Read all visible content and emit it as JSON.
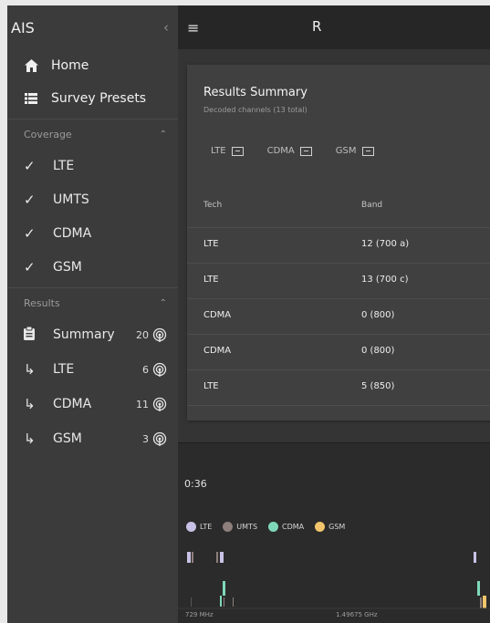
{
  "app": {
    "title": "AIS",
    "collapse_icon": "chevron-left-icon"
  },
  "topbar": {
    "menu_icon": "hamburger-icon",
    "title_fragment": "R"
  },
  "sidebar": {
    "nav": [
      {
        "label": "Home",
        "icon": "home-icon"
      },
      {
        "label": "Survey Presets",
        "icon": "list-icon"
      }
    ],
    "coverage": {
      "title": "Coverage",
      "items": [
        {
          "label": "LTE"
        },
        {
          "label": "UMTS"
        },
        {
          "label": "CDMA"
        },
        {
          "label": "GSM"
        }
      ]
    },
    "results": {
      "title": "Results",
      "items": [
        {
          "label": "Summary",
          "count": "20",
          "icon": "clipboard-icon"
        },
        {
          "label": "LTE",
          "count": "6",
          "icon": "subdirectory-arrow-icon"
        },
        {
          "label": "CDMA",
          "count": "11",
          "icon": "subdirectory-arrow-icon"
        },
        {
          "label": "GSM",
          "count": "3",
          "icon": "subdirectory-arrow-icon"
        }
      ]
    }
  },
  "card": {
    "title": "Results Summary",
    "subtitle": "Decoded channels (13 total)",
    "filters": [
      "LTE",
      "CDMA",
      "GSM"
    ],
    "columns": [
      "Tech",
      "Band"
    ],
    "rows": [
      {
        "tech": "LTE",
        "band": "12 (700 a)"
      },
      {
        "tech": "LTE",
        "band": "13 (700 c)"
      },
      {
        "tech": "CDMA",
        "band": "0 (800)"
      },
      {
        "tech": "CDMA",
        "band": "0 (800)"
      },
      {
        "tech": "LTE",
        "band": "5 (850)"
      }
    ]
  },
  "bottom": {
    "time": "0:36",
    "legend": [
      {
        "label": "LTE",
        "color": "#c9c2e6"
      },
      {
        "label": "UMTS",
        "color": "#8e7f7c"
      },
      {
        "label": "CDMA",
        "color": "#7fd9b9"
      },
      {
        "label": "GSM",
        "color": "#f1c56b"
      }
    ],
    "freq_start": "729 MHz",
    "freq_mid": "1.49675 GHz"
  }
}
